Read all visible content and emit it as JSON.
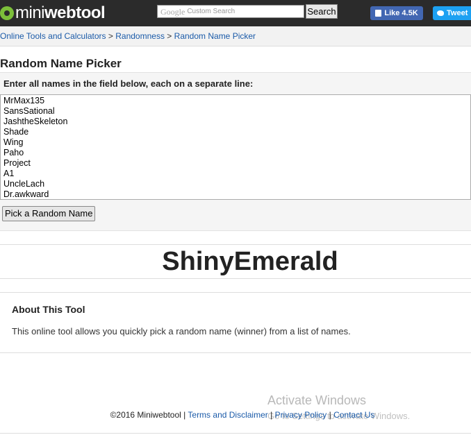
{
  "header": {
    "logo_mini": "mini",
    "logo_web": "web",
    "logo_tool": "tool",
    "search_brand": "Google",
    "search_placeholder": "Custom Search",
    "search_button": "Search",
    "like_label": "Like 4.5K",
    "tweet_label": "Tweet"
  },
  "breadcrumb": {
    "items": [
      "Online Tools and Calculators",
      "Randomness",
      "Random Name Picker"
    ],
    "separator": ">"
  },
  "main": {
    "title": "Random Name Picker",
    "instruction": "Enter all names in the field below, each on a separate line:",
    "names": [
      "MrMax135",
      "SansSational",
      "JashtheSkeleton",
      "Shade",
      "Wing",
      "Paho",
      "Project",
      "A1",
      "UncleLach",
      "Dr.awkward"
    ],
    "pick_button": "Pick a Random Name",
    "result": "ShinyEmerald"
  },
  "about": {
    "title": "About This Tool",
    "text": "This online tool allows you quickly pick a random name (winner) from a list of names."
  },
  "footer": {
    "copyright": "©2016 Miniwebtool",
    "links": [
      "Terms and Disclaimer",
      "Privacy Policy",
      "Contact Us"
    ],
    "divider": "|"
  },
  "watermark": {
    "title": "Activate Windows",
    "subtitle": "Go to Settings to activate Windows."
  },
  "colors": {
    "topbar": "#2b2b2b",
    "link": "#1a5aa8",
    "facebook": "#4267b2",
    "twitter": "#1da1f2",
    "logo_gear": "#7cbf3a"
  }
}
